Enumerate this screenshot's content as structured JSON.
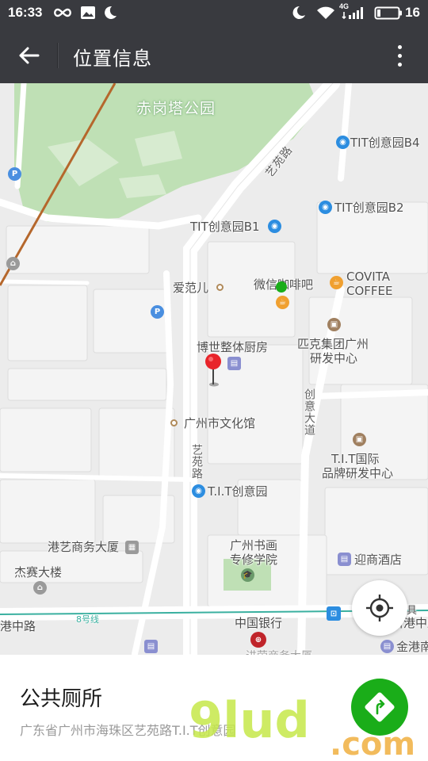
{
  "status_bar": {
    "time": "16:33",
    "battery": "16",
    "network": "4G"
  },
  "header": {
    "title": "位置信息",
    "back_icon": "arrow-left-icon",
    "more_icon": "more-vertical-icon"
  },
  "map": {
    "park": "赤岗塔公园",
    "roads": [
      "艺苑路",
      "艺苑路",
      "创意大道",
      "港中路",
      "中国银行"
    ],
    "road_labels": {
      "yiyuan_top": "艺苑路",
      "yiyuan_mid": "艺苑路",
      "chuangyi": "创意大道",
      "gangzhong": "港中路",
      "metro_line": "8号线"
    },
    "pois": {
      "tit_b4": "TIT创意园B4",
      "tit_b2": "TIT创意园B2",
      "tit_b1": "TIT创意园B1",
      "aifaner": "爱范儿",
      "weixin_cafe": "微信咖啡吧",
      "covita_1": "COVITA",
      "covita_2": "COFFEE",
      "boshi": "博世整体厨房",
      "pike_1": "匹克集团广州",
      "pike_2": "研发中心",
      "wenhuaguan": "广州市文化馆",
      "tit_intl_1": "T.I.T国际",
      "tit_intl_2": "品牌研发中心",
      "tit_park": "T.I.T创意园",
      "gangyi": "港艺商务大厦",
      "shuhua_1": "广州书画",
      "shuhua_2": "专修学院",
      "yingshang": "迎商酒店",
      "jiesai": "杰赛大楼",
      "bank": "中国银行",
      "gangzhong_left": "港中路",
      "gangzhong_right": "新港中路",
      "jingang": "金港南",
      "wenyi": "文具",
      "bottom_cut": "进荣商务大厦"
    }
  },
  "place": {
    "name": "公共厕所",
    "address": "广东省广州市海珠区艺苑路T.I.T创意园"
  },
  "colors": {
    "header_bg": "#393a3f",
    "nav_button": "#1aad19",
    "park_green": "#bfe0b5",
    "pin_red": "#e8242a"
  }
}
